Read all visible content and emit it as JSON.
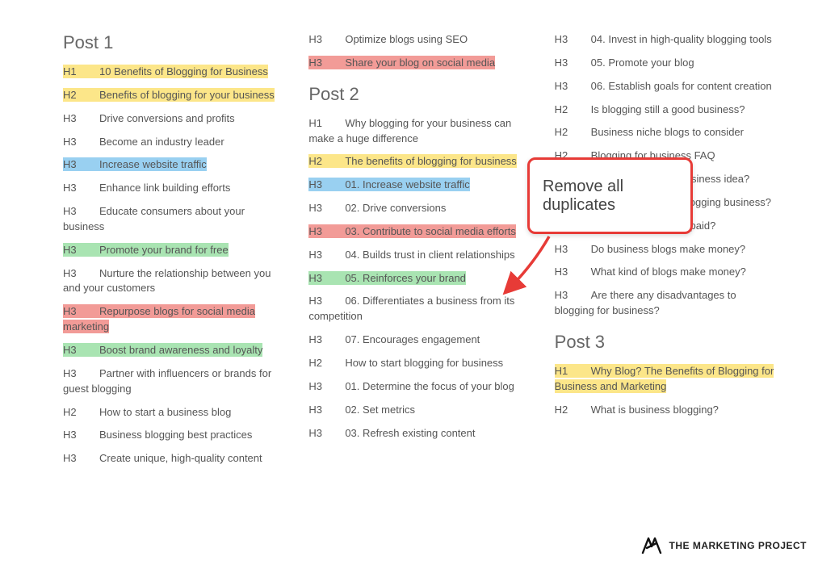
{
  "columns": [
    {
      "blocks": [
        {
          "kind": "title",
          "text": "Post 1"
        },
        {
          "kind": "entry",
          "tag": "H1",
          "text": "10 Benefits of Blogging for Business",
          "hl": "yellow"
        },
        {
          "kind": "entry",
          "tag": "H2",
          "text": "Benefits of blogging for your business",
          "hl": "yellow"
        },
        {
          "kind": "entry",
          "tag": "H3",
          "text": "Drive conversions and profits"
        },
        {
          "kind": "entry",
          "tag": "H3",
          "text": "Become an industry leader"
        },
        {
          "kind": "entry",
          "tag": "H3",
          "text": "Increase website traffic",
          "hl": "blue"
        },
        {
          "kind": "entry",
          "tag": "H3",
          "text": "Enhance link building efforts"
        },
        {
          "kind": "entry",
          "tag": "H3",
          "text": "Educate consumers about your business"
        },
        {
          "kind": "entry",
          "tag": "H3",
          "text": "Promote your brand for free",
          "hl": "green"
        },
        {
          "kind": "entry",
          "tag": "H3",
          "text": "Nurture the relationship between you and your customers"
        },
        {
          "kind": "entry",
          "tag": "H3",
          "text": "Repurpose blogs for social media marketing",
          "hl": "red"
        },
        {
          "kind": "entry",
          "tag": "H3",
          "text": "Boost brand awareness and loyalty",
          "hl": "green"
        },
        {
          "kind": "entry",
          "tag": "H3",
          "text": "Partner with influencers or brands for guest blogging"
        },
        {
          "kind": "entry",
          "tag": "H2",
          "text": "How to start a business blog"
        },
        {
          "kind": "entry",
          "tag": "H3",
          "text": "Business blogging best practices"
        },
        {
          "kind": "entry",
          "tag": "H3",
          "text": "Create unique, high-quality content"
        }
      ]
    },
    {
      "blocks": [
        {
          "kind": "entry",
          "tag": "H3",
          "text": "Optimize blogs using SEO"
        },
        {
          "kind": "entry",
          "tag": "H3",
          "text": "Share your blog on social media",
          "hl": "red"
        },
        {
          "kind": "title",
          "text": "Post 2"
        },
        {
          "kind": "entry",
          "tag": "H1",
          "text": "Why blogging for your business can make a huge difference"
        },
        {
          "kind": "entry",
          "tag": "H2",
          "text": "The benefits of blogging for business",
          "hl": "yellow"
        },
        {
          "kind": "entry",
          "tag": "H3",
          "text": "01. Increase website traffic",
          "hl": "blue"
        },
        {
          "kind": "entry",
          "tag": "H3",
          "text": "02. Drive conversions"
        },
        {
          "kind": "entry",
          "tag": "H3",
          "text": "03. Contribute to social media efforts",
          "hl": "red"
        },
        {
          "kind": "entry",
          "tag": "H3",
          "text": "04. Builds trust in client relationships"
        },
        {
          "kind": "entry",
          "tag": "H3",
          "text": "05. Reinforces your brand",
          "hl": "green"
        },
        {
          "kind": "entry",
          "tag": "H3",
          "text": "06. Differentiates a business from its competition"
        },
        {
          "kind": "entry",
          "tag": "H3",
          "text": "07. Encourages engagement"
        },
        {
          "kind": "entry",
          "tag": "H2",
          "text": "How to start blogging for business"
        },
        {
          "kind": "entry",
          "tag": "H3",
          "text": "01. Determine the focus of your blog"
        },
        {
          "kind": "entry",
          "tag": "H3",
          "text": "02. Set metrics"
        },
        {
          "kind": "entry",
          "tag": "H3",
          "text": "03. Refresh existing content"
        }
      ]
    },
    {
      "blocks": [
        {
          "kind": "entry",
          "tag": "H3",
          "text": "04. Invest in high-quality blogging tools"
        },
        {
          "kind": "entry",
          "tag": "H3",
          "text": "05. Promote your blog"
        },
        {
          "kind": "entry",
          "tag": "H3",
          "text": "06. Establish goals for content creation"
        },
        {
          "kind": "entry",
          "tag": "H2",
          "text": "Is blogging still a good business?"
        },
        {
          "kind": "entry",
          "tag": "H2",
          "text": "Business niche blogs to consider"
        },
        {
          "kind": "entry",
          "tag": "H2",
          "text": "Blogging for business FAQ"
        },
        {
          "kind": "entry",
          "tag": "H3",
          "text": "Is blogging a good business idea?"
        },
        {
          "kind": "entry",
          "tag": "H3",
          "text": "How do you start a blogging business?"
        },
        {
          "kind": "entry",
          "tag": "H3",
          "text": "How do bloggers get paid?"
        },
        {
          "kind": "entry",
          "tag": "H3",
          "text": "Do business blogs make money?"
        },
        {
          "kind": "entry",
          "tag": "H3",
          "text": "What kind of blogs make money?"
        },
        {
          "kind": "entry",
          "tag": "H3",
          "text": "Are there any disadvantages to blogging for business?"
        },
        {
          "kind": "title",
          "text": "Post 3"
        },
        {
          "kind": "entry",
          "tag": "H1",
          "text": "Why Blog? The Benefits of Blogging for Business and Marketing",
          "hl": "yellow"
        },
        {
          "kind": "entry",
          "tag": "H2",
          "text": "What is business blogging?"
        }
      ]
    }
  ],
  "callout": {
    "text": "Remove all duplicates"
  },
  "footer": {
    "brand": "THE MARKETING PROJECT"
  },
  "highlight_colors": {
    "yellow": "#fce689",
    "blue": "#99d0f1",
    "green": "#a9e4b2",
    "red": "#f29b97"
  }
}
